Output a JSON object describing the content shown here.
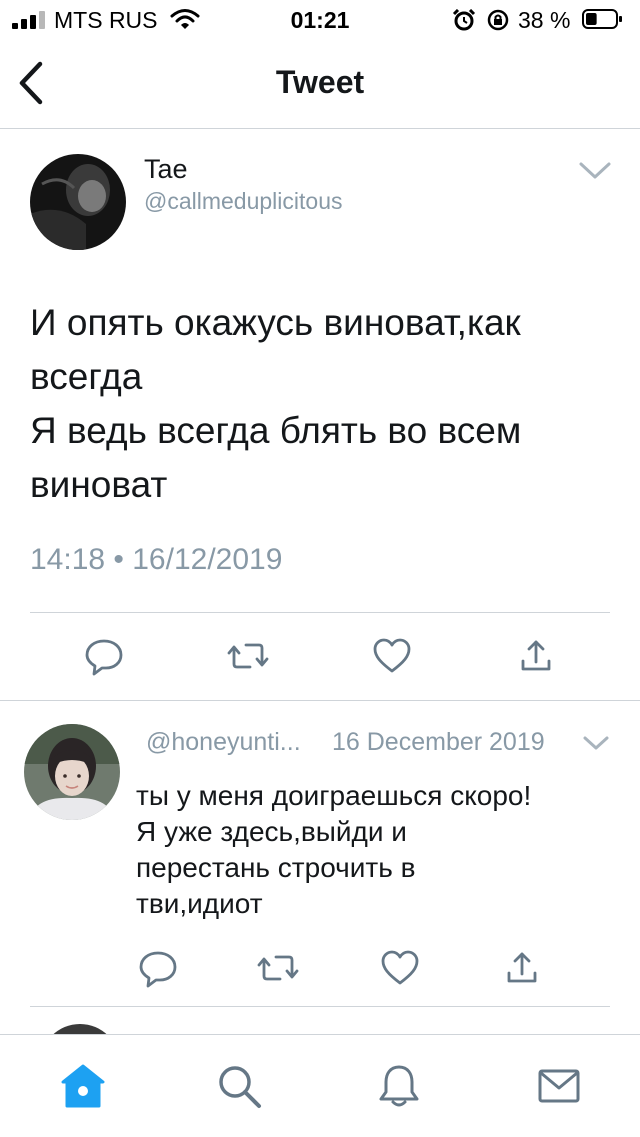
{
  "status_bar": {
    "carrier": "MTS RUS",
    "time": "01:21",
    "battery_percent": "38 %",
    "battery_level": 0.38
  },
  "nav": {
    "title": "Tweet"
  },
  "main_tweet": {
    "name": "Tae",
    "handle": "@callmeduplicitous",
    "text": "И опять окажусь виноват,как\nвсегда\nЯ ведь всегда блять во всем\nвиноват",
    "timestamp": "14:18 • 16/12/2019"
  },
  "reply": {
    "handle": "@honeyunti...",
    "date": "16 December 2019",
    "text": "ты у меня доиграешься скоро!\nЯ уже здесь,выйди и\nперестань строчить в\nтви,идиот"
  },
  "actions": [
    "reply-icon",
    "retweet-icon",
    "like-icon",
    "share-icon"
  ],
  "tabbar": [
    "home-icon",
    "search-icon",
    "notifications-icon",
    "messages-icon"
  ],
  "colors": {
    "text": "#14171a",
    "secondary": "#8899a6",
    "accent": "#1da1f2",
    "divider": "#cfd4d9"
  }
}
